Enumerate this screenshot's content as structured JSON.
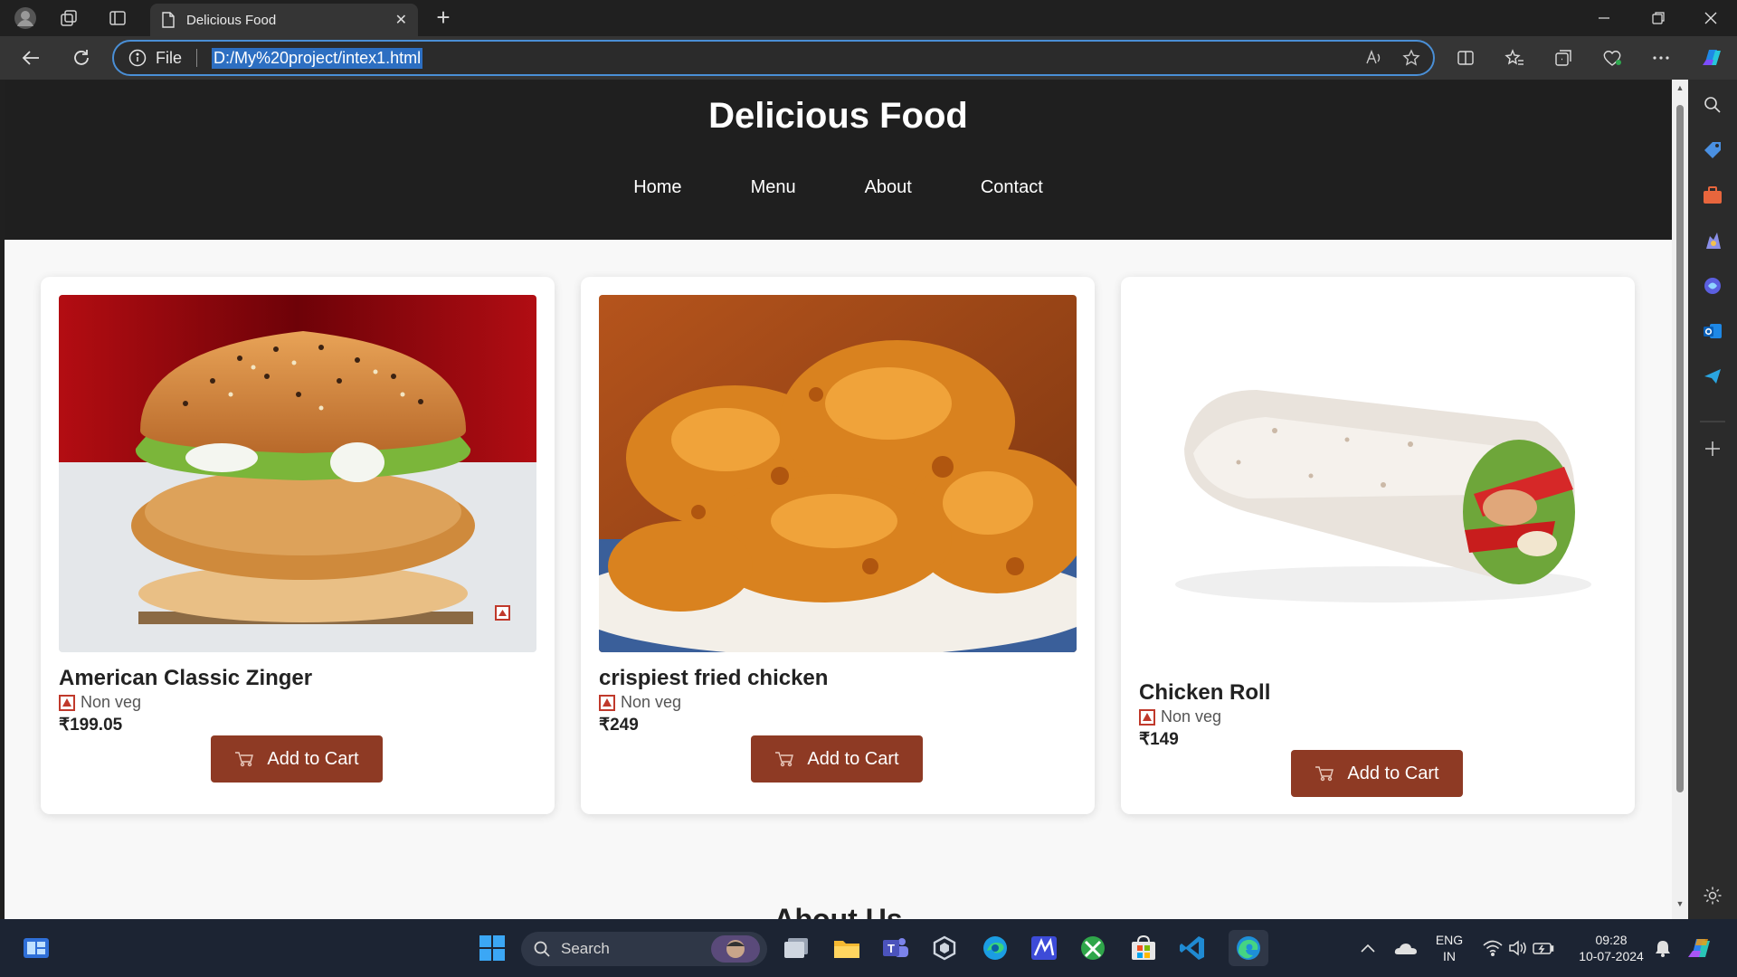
{
  "browser": {
    "tab_title": "Delicious Food",
    "address_scheme_label": "File",
    "address_url": "D:/My%20project/intex1.html"
  },
  "site": {
    "title": "Delicious Food",
    "nav": [
      "Home",
      "Menu",
      "About",
      "Contact"
    ],
    "products": [
      {
        "name": "American Classic Zinger",
        "category": "Non veg",
        "price": "₹199.05",
        "button": "Add to Cart",
        "image": "burger"
      },
      {
        "name": "crispiest fried chicken",
        "category": "Non veg",
        "price": "₹249",
        "button": "Add to Cart",
        "image": "fried-chicken"
      },
      {
        "name": "Chicken Roll",
        "category": "Non veg",
        "price": "₹149",
        "button": "Add to Cart",
        "image": "chicken-roll"
      }
    ],
    "about_heading": "About Us"
  },
  "taskbar": {
    "search_placeholder": "Search",
    "language": "ENG",
    "region": "IN",
    "time": "09:28",
    "date": "10-07-2024"
  },
  "colors": {
    "header_bg": "#1f1f1f",
    "button_bg": "#8e3a24",
    "nonveg_mark": "#c0392b",
    "address_focus": "#4a8fd6"
  }
}
